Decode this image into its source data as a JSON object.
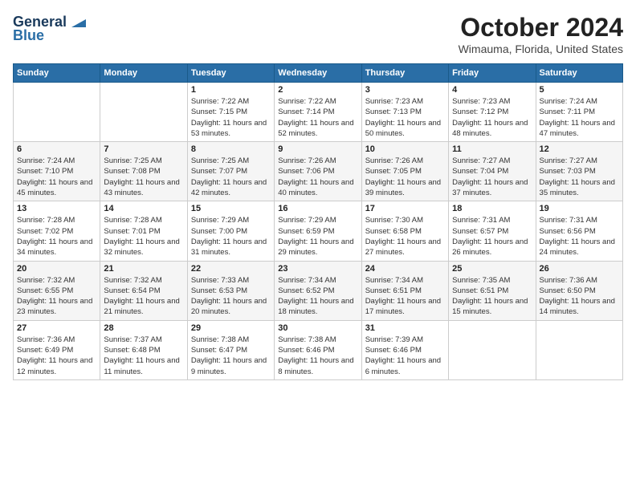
{
  "logo": {
    "line1": "General",
    "line2": "Blue"
  },
  "title": "October 2024",
  "location": "Wimauma, Florida, United States",
  "days_of_week": [
    "Sunday",
    "Monday",
    "Tuesday",
    "Wednesday",
    "Thursday",
    "Friday",
    "Saturday"
  ],
  "weeks": [
    [
      {
        "day": "",
        "info": ""
      },
      {
        "day": "",
        "info": ""
      },
      {
        "day": "1",
        "info": "Sunrise: 7:22 AM\nSunset: 7:15 PM\nDaylight: 11 hours and 53 minutes."
      },
      {
        "day": "2",
        "info": "Sunrise: 7:22 AM\nSunset: 7:14 PM\nDaylight: 11 hours and 52 minutes."
      },
      {
        "day": "3",
        "info": "Sunrise: 7:23 AM\nSunset: 7:13 PM\nDaylight: 11 hours and 50 minutes."
      },
      {
        "day": "4",
        "info": "Sunrise: 7:23 AM\nSunset: 7:12 PM\nDaylight: 11 hours and 48 minutes."
      },
      {
        "day": "5",
        "info": "Sunrise: 7:24 AM\nSunset: 7:11 PM\nDaylight: 11 hours and 47 minutes."
      }
    ],
    [
      {
        "day": "6",
        "info": "Sunrise: 7:24 AM\nSunset: 7:10 PM\nDaylight: 11 hours and 45 minutes."
      },
      {
        "day": "7",
        "info": "Sunrise: 7:25 AM\nSunset: 7:08 PM\nDaylight: 11 hours and 43 minutes."
      },
      {
        "day": "8",
        "info": "Sunrise: 7:25 AM\nSunset: 7:07 PM\nDaylight: 11 hours and 42 minutes."
      },
      {
        "day": "9",
        "info": "Sunrise: 7:26 AM\nSunset: 7:06 PM\nDaylight: 11 hours and 40 minutes."
      },
      {
        "day": "10",
        "info": "Sunrise: 7:26 AM\nSunset: 7:05 PM\nDaylight: 11 hours and 39 minutes."
      },
      {
        "day": "11",
        "info": "Sunrise: 7:27 AM\nSunset: 7:04 PM\nDaylight: 11 hours and 37 minutes."
      },
      {
        "day": "12",
        "info": "Sunrise: 7:27 AM\nSunset: 7:03 PM\nDaylight: 11 hours and 35 minutes."
      }
    ],
    [
      {
        "day": "13",
        "info": "Sunrise: 7:28 AM\nSunset: 7:02 PM\nDaylight: 11 hours and 34 minutes."
      },
      {
        "day": "14",
        "info": "Sunrise: 7:28 AM\nSunset: 7:01 PM\nDaylight: 11 hours and 32 minutes."
      },
      {
        "day": "15",
        "info": "Sunrise: 7:29 AM\nSunset: 7:00 PM\nDaylight: 11 hours and 31 minutes."
      },
      {
        "day": "16",
        "info": "Sunrise: 7:29 AM\nSunset: 6:59 PM\nDaylight: 11 hours and 29 minutes."
      },
      {
        "day": "17",
        "info": "Sunrise: 7:30 AM\nSunset: 6:58 PM\nDaylight: 11 hours and 27 minutes."
      },
      {
        "day": "18",
        "info": "Sunrise: 7:31 AM\nSunset: 6:57 PM\nDaylight: 11 hours and 26 minutes."
      },
      {
        "day": "19",
        "info": "Sunrise: 7:31 AM\nSunset: 6:56 PM\nDaylight: 11 hours and 24 minutes."
      }
    ],
    [
      {
        "day": "20",
        "info": "Sunrise: 7:32 AM\nSunset: 6:55 PM\nDaylight: 11 hours and 23 minutes."
      },
      {
        "day": "21",
        "info": "Sunrise: 7:32 AM\nSunset: 6:54 PM\nDaylight: 11 hours and 21 minutes."
      },
      {
        "day": "22",
        "info": "Sunrise: 7:33 AM\nSunset: 6:53 PM\nDaylight: 11 hours and 20 minutes."
      },
      {
        "day": "23",
        "info": "Sunrise: 7:34 AM\nSunset: 6:52 PM\nDaylight: 11 hours and 18 minutes."
      },
      {
        "day": "24",
        "info": "Sunrise: 7:34 AM\nSunset: 6:51 PM\nDaylight: 11 hours and 17 minutes."
      },
      {
        "day": "25",
        "info": "Sunrise: 7:35 AM\nSunset: 6:51 PM\nDaylight: 11 hours and 15 minutes."
      },
      {
        "day": "26",
        "info": "Sunrise: 7:36 AM\nSunset: 6:50 PM\nDaylight: 11 hours and 14 minutes."
      }
    ],
    [
      {
        "day": "27",
        "info": "Sunrise: 7:36 AM\nSunset: 6:49 PM\nDaylight: 11 hours and 12 minutes."
      },
      {
        "day": "28",
        "info": "Sunrise: 7:37 AM\nSunset: 6:48 PM\nDaylight: 11 hours and 11 minutes."
      },
      {
        "day": "29",
        "info": "Sunrise: 7:38 AM\nSunset: 6:47 PM\nDaylight: 11 hours and 9 minutes."
      },
      {
        "day": "30",
        "info": "Sunrise: 7:38 AM\nSunset: 6:46 PM\nDaylight: 11 hours and 8 minutes."
      },
      {
        "day": "31",
        "info": "Sunrise: 7:39 AM\nSunset: 6:46 PM\nDaylight: 11 hours and 6 minutes."
      },
      {
        "day": "",
        "info": ""
      },
      {
        "day": "",
        "info": ""
      }
    ]
  ]
}
